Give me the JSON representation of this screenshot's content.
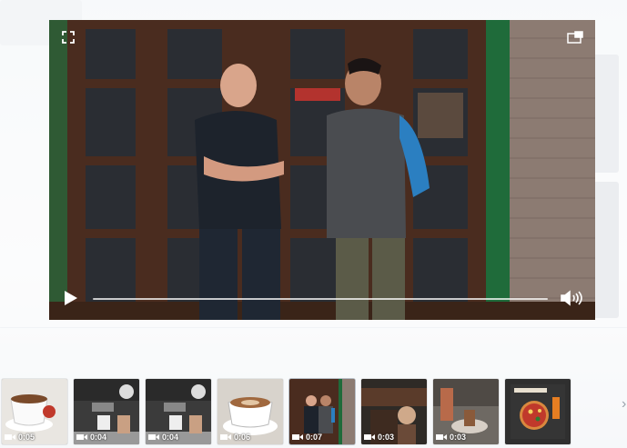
{
  "player": {
    "progress_fraction": 0.0,
    "controls": {
      "fullscreen_icon": "expand-corners-icon",
      "pip_icon": "picture-in-picture-icon",
      "play_icon": "play-icon",
      "volume_icon": "speaker-icon"
    },
    "accent_color": "#2e7d4a"
  },
  "thumbnails": [
    {
      "kind": "video",
      "duration": "0:05",
      "icon": "video-camera-icon",
      "scene": "espresso-cup"
    },
    {
      "kind": "video",
      "duration": "0:04",
      "icon": "video-camera-icon",
      "scene": "espresso-machine"
    },
    {
      "kind": "video",
      "duration": "0:04",
      "icon": "video-camera-icon",
      "scene": "espresso-machine"
    },
    {
      "kind": "video",
      "duration": "0:06",
      "icon": "video-camera-icon",
      "scene": "latte-cup"
    },
    {
      "kind": "video",
      "duration": "0:07",
      "icon": "video-camera-icon",
      "scene": "two-men-storefront",
      "active": true
    },
    {
      "kind": "video",
      "duration": "0:03",
      "icon": "video-camera-icon",
      "scene": "barista"
    },
    {
      "kind": "video",
      "duration": "0:03",
      "icon": "video-camera-icon",
      "scene": "pouring"
    },
    {
      "kind": "image",
      "duration": "",
      "icon": "",
      "scene": "pizza-flyer"
    }
  ]
}
